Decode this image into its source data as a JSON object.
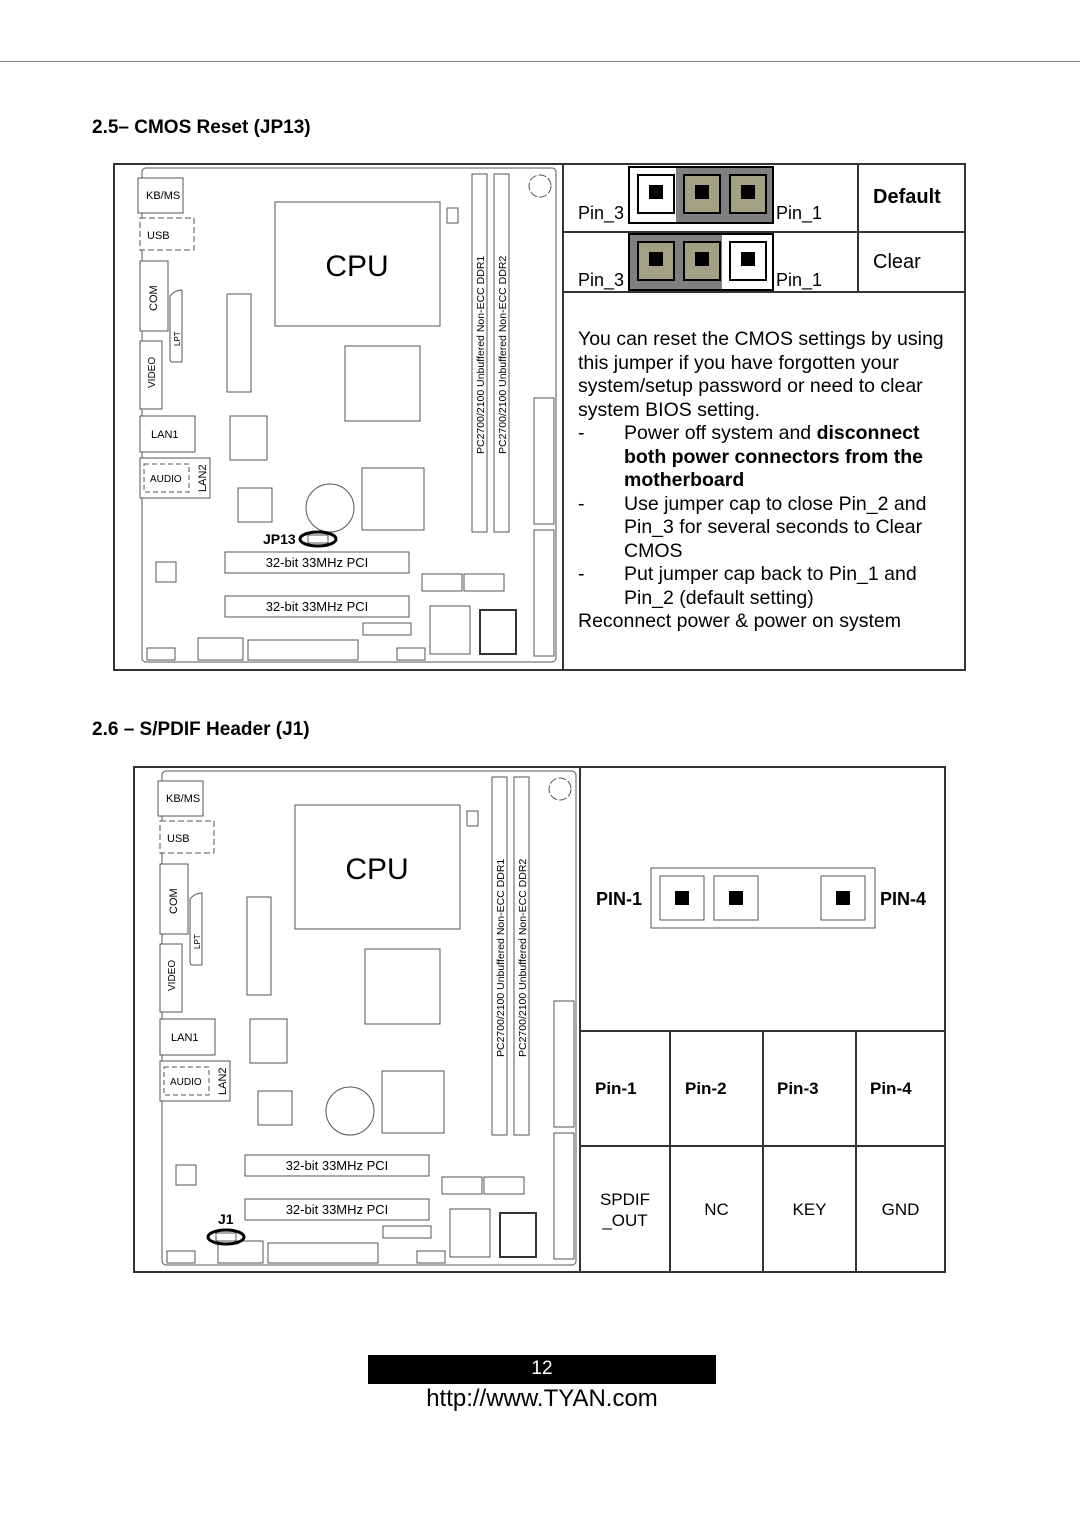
{
  "section_cmos": {
    "title": "2.5– CMOS Reset (JP13)",
    "board": {
      "cpu_label": "CPU",
      "ports": [
        "KB/MS",
        "USB",
        "COM",
        "LPT",
        "VIDEO",
        "LAN1",
        "AUDIO",
        "LAN2"
      ],
      "dimm1": "PC2700/2100 Unbuffered Non-ECC DDR1",
      "dimm2": "PC2700/2100 Unbuffered Non-ECC DDR2",
      "pci1": "32-bit 33MHz PCI",
      "pci2": "32-bit 33MHz PCI",
      "jumper_label": "JP13"
    },
    "settings": [
      {
        "left_label": "Pin_3",
        "right_label": "Pin_1",
        "name": "Default",
        "bold": true,
        "capped_pins": [
          1,
          2
        ]
      },
      {
        "left_label": "Pin_3",
        "right_label": "Pin_1",
        "name": "Clear",
        "bold": false,
        "capped_pins": [
          2,
          3
        ]
      }
    ],
    "description": {
      "intro": "You can reset the CMOS settings by using this jumper if you have forgotten your system/setup password or need to clear system BIOS setting.",
      "steps": [
        {
          "dash": "-",
          "text_normal": "Power off system and ",
          "text_bold": "disconnect both power connectors from the motherboard"
        },
        {
          "dash": "-",
          "text_normal": "Use jumper cap to close Pin_2 and Pin_3 for several seconds to Clear CMOS",
          "text_bold": ""
        },
        {
          "dash": "-",
          "text_normal": "Put jumper cap back to Pin_1 and Pin_2 (default setting)",
          "text_bold": ""
        }
      ],
      "outro": "Reconnect power & power on system"
    }
  },
  "section_spdif": {
    "title": "2.6 – S/PDIF Header (J1)",
    "board": {
      "cpu_label": "CPU",
      "ports": [
        "KB/MS",
        "USB",
        "COM",
        "LPT",
        "VIDEO",
        "LAN1",
        "AUDIO",
        "LAN2"
      ],
      "dimm1": "PC2700/2100 Unbuffered Non-ECC DDR1",
      "dimm2": "PC2700/2100 Unbuffered Non-ECC DDR2",
      "pci1": "32-bit 33MHz PCI",
      "pci2": "32-bit 33MHz PCI",
      "jumper_label": "J1"
    },
    "header_left": "PIN-1",
    "header_right": "PIN-4",
    "pin_headers": [
      "Pin-1",
      "Pin-2",
      "Pin-3",
      "Pin-4"
    ],
    "pin_values": [
      "SPDIF\n_OUT",
      "NC",
      "KEY",
      "GND"
    ]
  },
  "colors": {
    "cap_fill": "#a3a183",
    "cap_bg": "#808080"
  },
  "footer": {
    "page_number": "12",
    "url": "http://www.TYAN.com"
  }
}
